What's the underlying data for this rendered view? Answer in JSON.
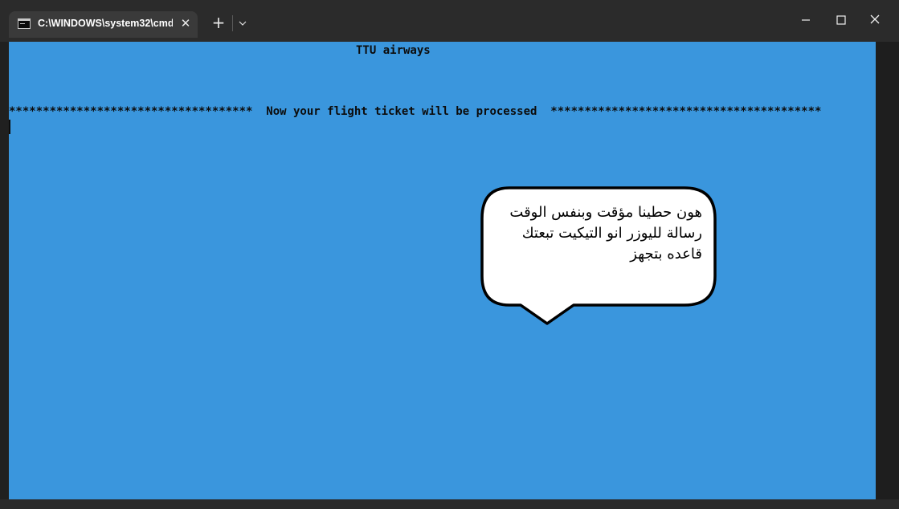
{
  "window": {
    "tab_title": "C:\\WINDOWS\\system32\\cmd.",
    "tab_close_glyph": "✕",
    "new_tab_glyph": "+"
  },
  "terminal": {
    "background_color": "#3a96dd",
    "text_color": "#0c0c0c",
    "lines": {
      "title": "TTU airways",
      "message": "************************************  Now your flight ticket will be processed  ****************************************"
    }
  },
  "annotation": {
    "text": "هون حطينا مؤقت وبنفس الوقت رسالة لليوزر انو التيكيت تبعتك قاعده بتجهز"
  },
  "icons": {
    "tab_icon": "terminal-icon",
    "close": "close-icon",
    "new_tab": "plus-icon",
    "dropdown": "chevron-down-icon",
    "minimize": "minimize-icon",
    "maximize": "maximize-icon",
    "window_close": "close-icon"
  }
}
